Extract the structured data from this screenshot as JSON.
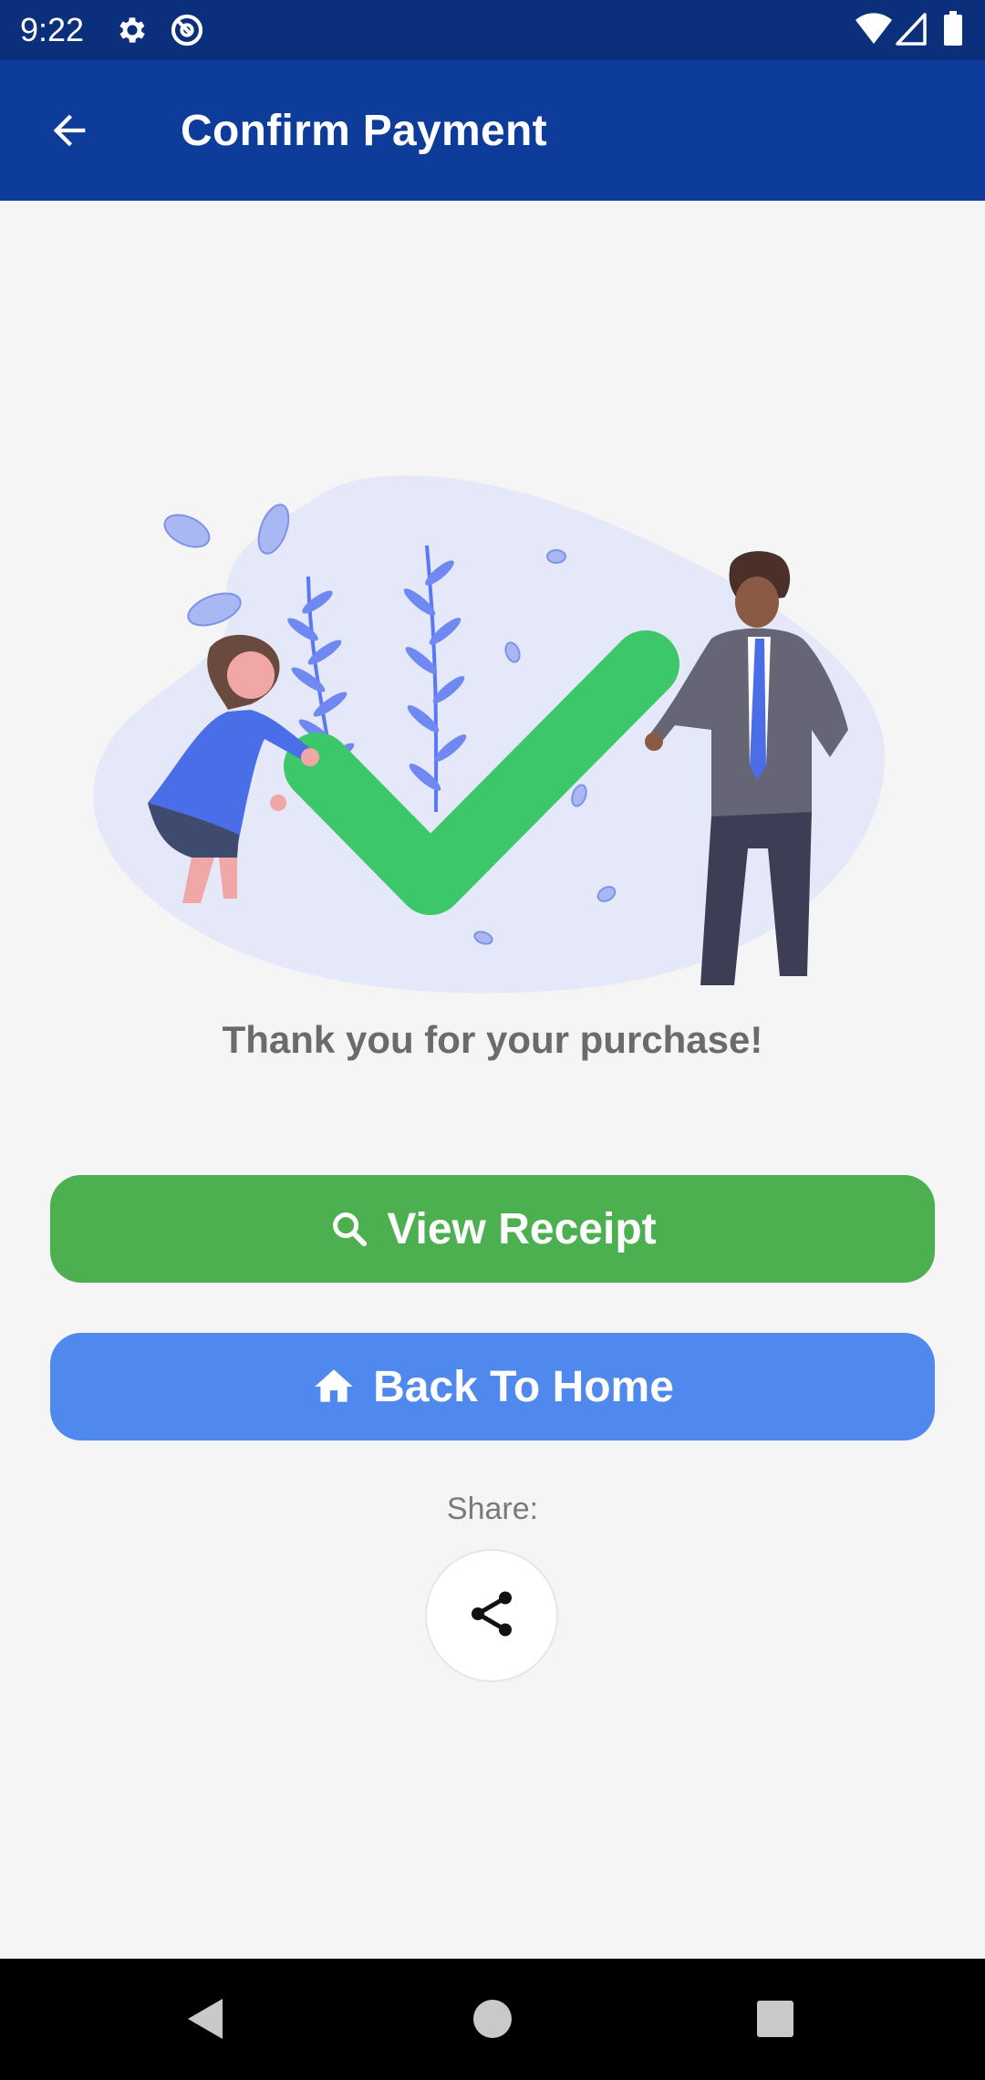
{
  "status_bar": {
    "time": "9:22",
    "icons_left": [
      "settings-icon",
      "at-sign-icon"
    ],
    "icons_right": [
      "wifi-icon",
      "signal-icon",
      "battery-icon"
    ]
  },
  "app_bar": {
    "title": "Confirm Payment",
    "back_icon": "arrow-left-icon",
    "background": "#0d3c9a"
  },
  "illustration": {
    "subject": "payment-success-checkmark",
    "check_color": "#3cc86a",
    "accent_color": "#5a78f5"
  },
  "message": {
    "text": "Thank you for your purchase!"
  },
  "buttons": {
    "view_receipt": {
      "label": "View Receipt",
      "icon": "search-icon",
      "color": "#4caf50"
    },
    "back_home": {
      "label": "Back To Home",
      "icon": "home-icon",
      "color": "#5089ed"
    }
  },
  "share": {
    "label": "Share:",
    "icon": "share-icon"
  },
  "nav_bar": {
    "buttons": [
      "back-triangle-icon",
      "home-circle-icon",
      "recents-square-icon"
    ]
  }
}
